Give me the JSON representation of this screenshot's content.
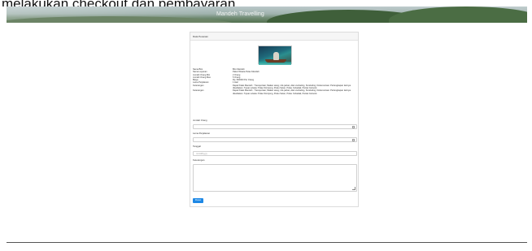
{
  "page": {
    "top_caption": "melakukan checkout dan pembayaran.",
    "site_title": "Mandeh Travelling"
  },
  "card": {
    "header": "Data Pesanan"
  },
  "details": [
    {
      "key": "Nama Biro",
      "value": "Biro Mandeh"
    },
    {
      "key": "Nama Layanan",
      "value": "Paket Wisata Pulau Mandeh"
    },
    {
      "key": "Jumlah Orang Min",
      "value": "2 Orang"
    },
    {
      "key": "Jumlah Orang Max",
      "value": "5 Orang"
    },
    {
      "key": "Biaya",
      "value": "Rp. 500000 Per Orang"
    },
    {
      "key": "Lama Perjalanan",
      "value": "1 Hari"
    },
    {
      "key": "Keterangan",
      "value": "Dapat Paket Mandeh : Transportasi, Makan siang, Life jacket, Alat snorkeling, Snorkeling, Dokumentasi. Perlengkapan lainnya disediakan. Tujuan wisata: Pulau Sironjong, Pulau Setan, Pulau Cubadak, Pantai Carocok."
    },
    {
      "key": "Keterangan",
      "value": "Dapat Paket Mandeh : Transportasi, Makan siang, Life jacket, Alat snorkeling, Snorkeling, Dokumentasi. Perlengkapan lainnya disediakan. Tujuan wisata: Pulau Sironjong, Pulau Setan, Pulau Cubadak, Pantai Carocok."
    }
  ],
  "form": {
    "jumlah_orang_label": "Jumlah Orang",
    "lama_label": "Lama Perjalanan",
    "tanggal_label": "Tanggal",
    "tanggal_placeholder": "mm/dd/yyyy",
    "keterangan_label": "Keterangan",
    "submit_label": "Pesan"
  }
}
